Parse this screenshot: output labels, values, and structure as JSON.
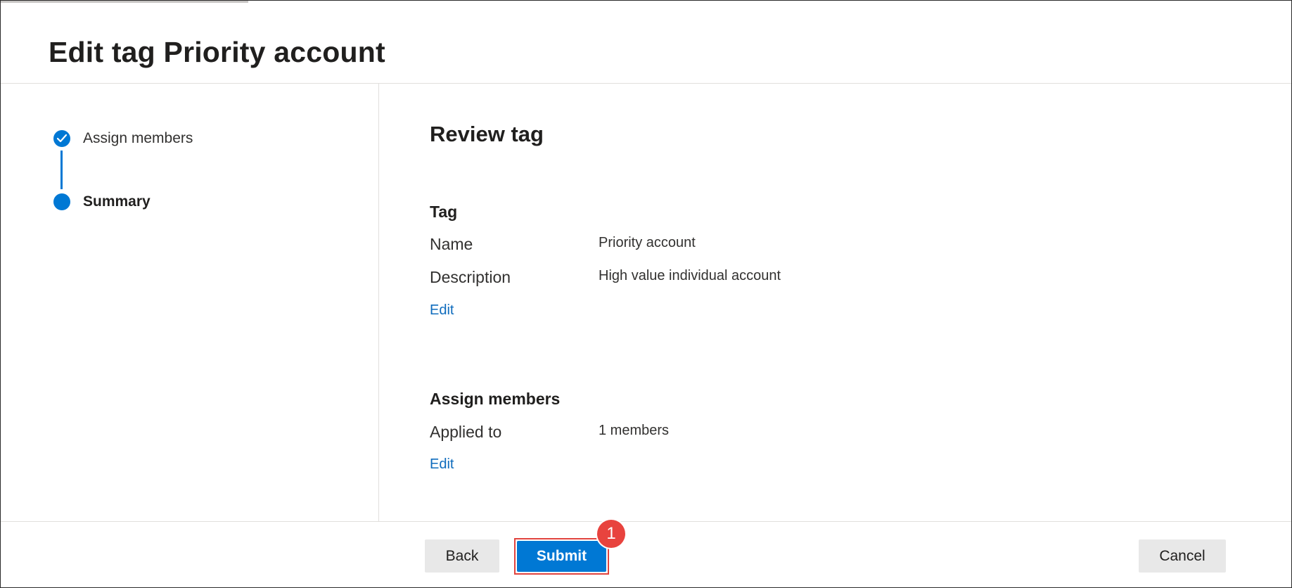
{
  "header": {
    "title": "Edit tag Priority account"
  },
  "steps": [
    {
      "label": "Assign members",
      "status": "complete"
    },
    {
      "label": "Summary",
      "status": "current"
    }
  ],
  "review": {
    "title": "Review tag",
    "tag_section": {
      "heading": "Tag",
      "name_label": "Name",
      "name_value": "Priority account",
      "description_label": "Description",
      "description_value": "High value individual account",
      "edit_label": "Edit"
    },
    "members_section": {
      "heading": "Assign members",
      "applied_label": "Applied to",
      "applied_value": "1 members",
      "edit_label": "Edit"
    }
  },
  "footer": {
    "back_label": "Back",
    "submit_label": "Submit",
    "cancel_label": "Cancel"
  },
  "annotation": {
    "badge_number": "1"
  },
  "colors": {
    "accent": "#0078d4",
    "link": "#0f6cbd",
    "annotation": "#e8433e"
  },
  "icons": {
    "step_done": "checkmark-icon"
  }
}
